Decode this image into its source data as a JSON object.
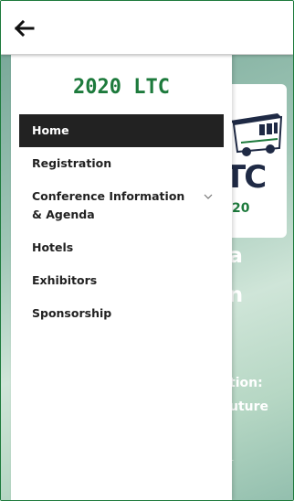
{
  "topbar": {
    "back_icon": "back-arrow-icon"
  },
  "background_page": {
    "logo_letters": "TC",
    "logo_year": "20",
    "heading_line1": "na",
    "heading_line2": "on",
    "subtitle_line1": "tion:",
    "subtitle_line2": "uture",
    "small_text": "r"
  },
  "drawer": {
    "title": "2020 LTC",
    "items": [
      {
        "label": "Home",
        "active": true
      },
      {
        "label": "Registration"
      },
      {
        "label": "Conference Information & Agenda",
        "icon": "chevron-down-icon"
      },
      {
        "label": "Hotels"
      },
      {
        "label": "Exhibitors"
      },
      {
        "label": "Sponsorship"
      }
    ]
  },
  "colors": {
    "brand_green": "#1d7a3c",
    "active_bg": "#222222"
  }
}
